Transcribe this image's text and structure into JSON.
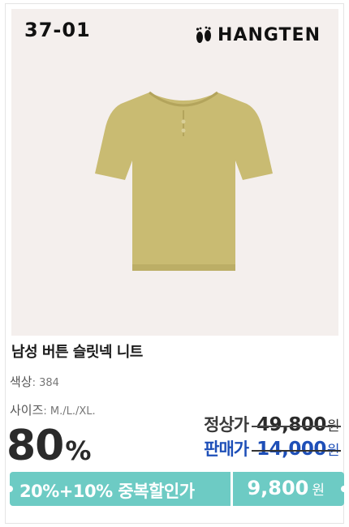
{
  "product": {
    "code": "37-01",
    "brand": "HANGTEN",
    "name": "남성 버튼 슬릿넥 니트",
    "color_label": "색상",
    "color_value": ": 384",
    "size_label": "사이즈",
    "size_value": ": M./L./XL."
  },
  "pricing": {
    "discount_number": "80",
    "discount_symbol": "%",
    "regular_label": "정상가",
    "regular_price": "49,800",
    "sale_label": "판매가",
    "sale_price": "14,000",
    "currency": "원"
  },
  "banner": {
    "text": "20%+10% 중복할인가",
    "price": "9,800",
    "currency": "원"
  },
  "colors": {
    "photo_bg": "#f4efed",
    "shirt": "#c9bb72",
    "banner": "#6dcbc4",
    "sale_blue": "#1e4fb8"
  },
  "icons": [
    "feet-icon",
    "shirt-image"
  ]
}
